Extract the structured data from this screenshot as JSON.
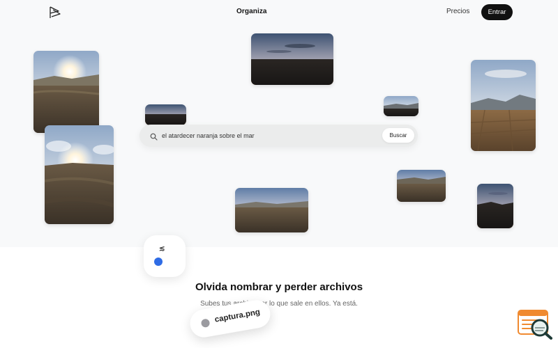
{
  "nav": {
    "brand": "Organiza",
    "pricing_link": "Precios",
    "login_button": "Entrar",
    "logo_icon": "brand-logo-icon"
  },
  "search": {
    "query": "el atardecer naranja sobre el mar",
    "button_label": "Buscar",
    "icon": "search-icon"
  },
  "photos": [
    {
      "subject": "sunset-field-with-sun"
    },
    {
      "subject": "sunset-over-hills"
    },
    {
      "subject": "orange-sky-horizon"
    },
    {
      "subject": "distant-mountains"
    },
    {
      "subject": "valley-with-fields"
    },
    {
      "subject": "sun-flare-field"
    },
    {
      "subject": "dusk-field"
    },
    {
      "subject": "twilight-landscape"
    },
    {
      "subject": "mountain-silhouette"
    }
  ],
  "feature": {
    "heading": "Olvida nombrar y perder archivos",
    "subtext": "Subes tus archi… por lo que sale en ellos. Ya está.",
    "file_pill": "captura.png",
    "card_mark": "≲"
  },
  "colors": {
    "accent_blue": "#2f6ce5",
    "button_dark": "#111111",
    "widget_orange": "#f08a30"
  }
}
